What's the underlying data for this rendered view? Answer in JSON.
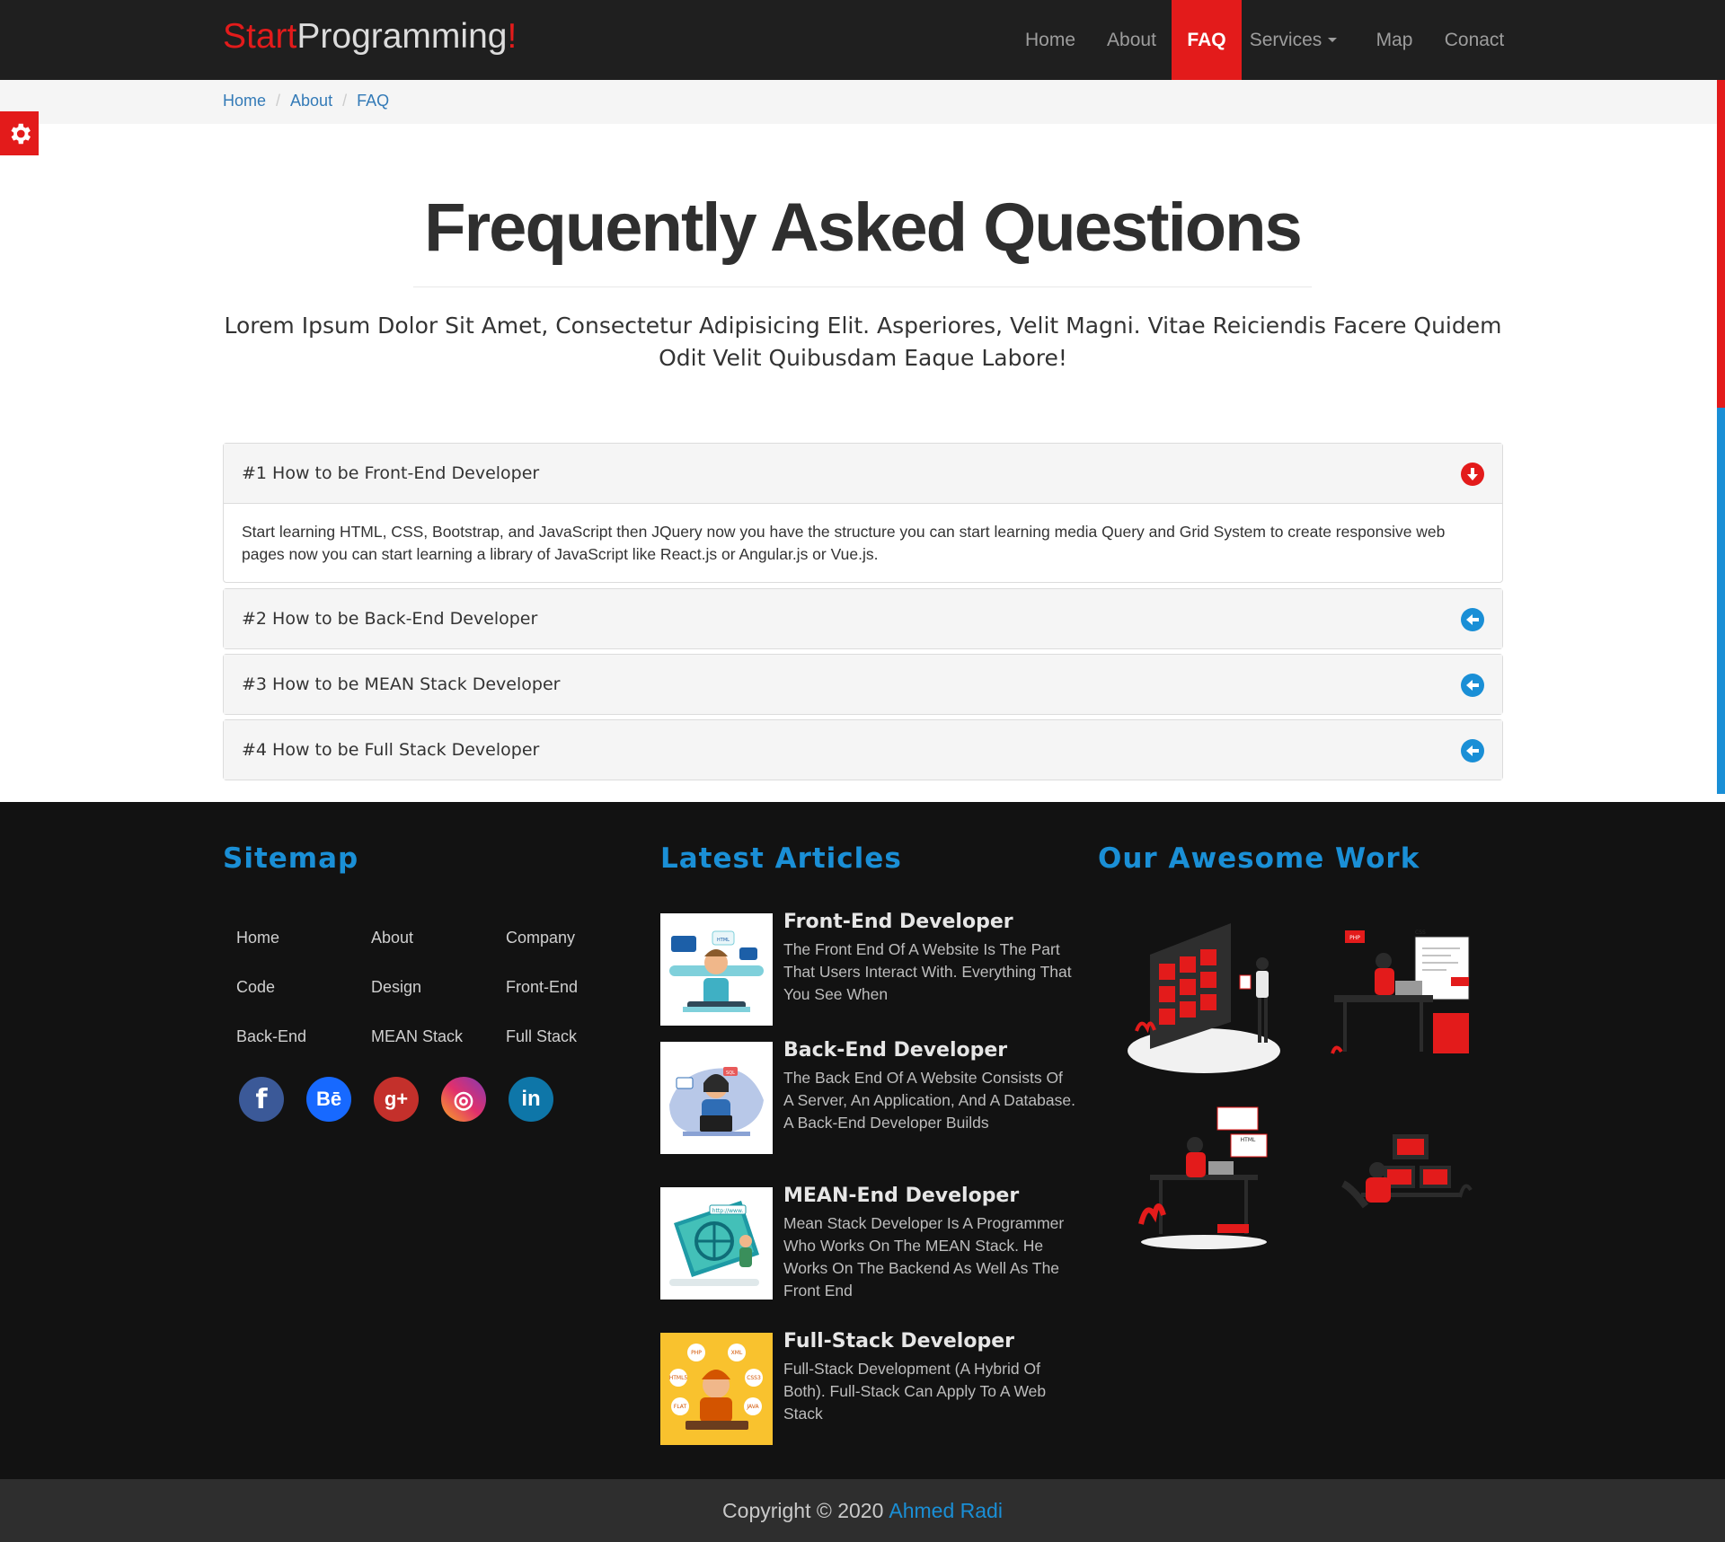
{
  "brand": {
    "part1": "Start",
    "part2": "Programming",
    "part3": "!"
  },
  "nav": {
    "home": "Home",
    "about": "About",
    "faq": "FAQ",
    "services": "Services",
    "map": "Map",
    "contact": "Conact"
  },
  "breadcrumb": [
    "Home",
    "About",
    "FAQ"
  ],
  "page": {
    "title": "Frequently Asked Questions",
    "lead": "Lorem Ipsum Dolor Sit Amet, Consectetur Adipisicing Elit. Asperiores, Velit Magni. Vitae Reiciendis Facere Quidem Odit Velit Quibusdam Eaque Labore!"
  },
  "faq": [
    {
      "question": "#1 How to be Front-End Developer",
      "answer": "Start learning HTML, CSS, Bootstrap, and JavaScript then JQuery now you have the structure you can start learning media Query and Grid System to create responsive web pages now you can start learning a library of JavaScript like React.js or Angular.js or Vue.js.",
      "expanded": true,
      "icon": "arrow-down-circle-icon",
      "color": "#e31b1b"
    },
    {
      "question": "#2 How to be Back-End Developer",
      "expanded": false,
      "icon": "arrow-left-circle-icon",
      "color": "#1a8fd6"
    },
    {
      "question": "#3 How to be MEAN Stack Developer",
      "expanded": false,
      "icon": "arrow-left-circle-icon",
      "color": "#1a8fd6"
    },
    {
      "question": "#4 How to be Full Stack Developer",
      "expanded": false,
      "icon": "arrow-left-circle-icon",
      "color": "#1a8fd6"
    }
  ],
  "footer": {
    "sitemap_title": "Sitemap",
    "articles_title": "Latest Articles",
    "work_title": "Our Awesome Work",
    "sitemap_links": [
      "Home",
      "About",
      "Company",
      "Code",
      "Design",
      "Front-End",
      "Back-End",
      "MEAN Stack",
      "Full Stack"
    ],
    "social": [
      {
        "name": "facebook-icon",
        "glyph": "f",
        "color": "#3b5998"
      },
      {
        "name": "behance-icon",
        "glyph": "Bē",
        "color": "#1769ff"
      },
      {
        "name": "google-plus-icon",
        "glyph": "g+",
        "color": "#c4302b"
      },
      {
        "name": "instagram-icon",
        "glyph": "◎",
        "color": "#c13584"
      },
      {
        "name": "linkedin-icon",
        "glyph": "in",
        "color": "#0e76a8"
      }
    ],
    "articles": [
      {
        "title": "Front-End Developer",
        "text": "The Front End Of A Website Is The Part That Users Interact With. Everything That You See When"
      },
      {
        "title": "Back-End Developer",
        "text": "The Back End Of A Website Consists Of A Server, An Application, And A Database. A Back-End Developer Builds"
      },
      {
        "title": "MEAN-End Developer",
        "text": "Mean Stack Developer Is A Programmer Who Works On The MEAN Stack. He Works On The Backend As Well As The Front End"
      },
      {
        "title": "Full-Stack Developer",
        "text": "Full-Stack Development (A Hybrid Of Both). Full-Stack Can Apply To A Web Stack"
      }
    ],
    "thumb_labels": {
      "html": "HTML",
      "sql": "SQL",
      "http": "http://www.",
      "php": "PHP",
      "xml": "XML",
      "html5": "HTML5",
      "css3": "CSS3",
      "flat": "FLAT",
      "java": "JAVA"
    },
    "work_labels": {
      "php": "PHP",
      "css": "CSS",
      "html": "HTML"
    }
  },
  "copyright": {
    "text": "Copyright © 2020",
    "author": "Ahmed Radi"
  },
  "colors": {
    "accent_red": "#e31b1b",
    "accent_blue": "#1a8fd6",
    "nav_bg": "#1f1f1f",
    "footer_bg": "#121212"
  }
}
